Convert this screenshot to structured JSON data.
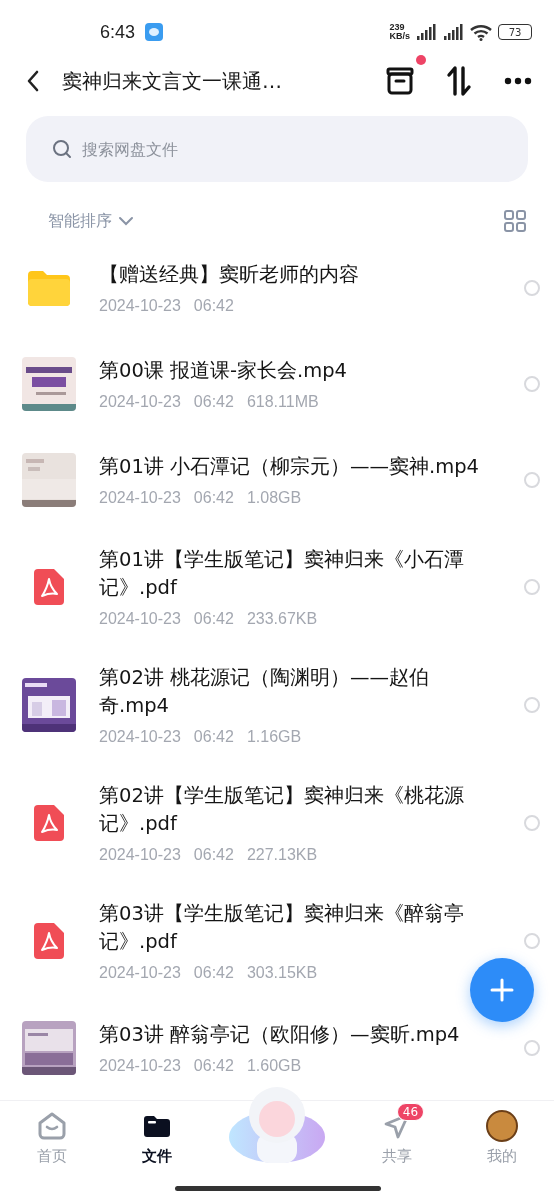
{
  "status_bar": {
    "time": "6:43",
    "speed": "239",
    "speed_unit": "KB/s",
    "battery": "73"
  },
  "header": {
    "title": "窦神归来文言文一课通…",
    "has_notice_dot": true
  },
  "search": {
    "placeholder": "搜索网盘文件"
  },
  "sort": {
    "label": "智能排序"
  },
  "files": [
    {
      "kind": "folder",
      "name": "【赠送经典】窦昕老师的内容",
      "meta": [
        "2024-10-23",
        "06:42"
      ],
      "selected": false
    },
    {
      "kind": "video",
      "name": "第00课 报道课-家长会.mp4",
      "meta": [
        "2024-10-23",
        "06:42",
        "618.11MB"
      ],
      "selected": false
    },
    {
      "kind": "video",
      "name": "第01讲 小石潭记（柳宗元）——窦神.mp4",
      "meta": [
        "2024-10-23",
        "06:42",
        "1.08GB"
      ],
      "selected": false
    },
    {
      "kind": "pdf",
      "name": "第01讲【学生版笔记】窦神归来《小石潭记》.pdf",
      "meta": [
        "2024-10-23",
        "06:42",
        "233.67KB"
      ],
      "selected": false
    },
    {
      "kind": "video",
      "name": "第02讲 桃花源记（陶渊明）——赵伯奇.mp4",
      "meta": [
        "2024-10-23",
        "06:42",
        "1.16GB"
      ],
      "selected": false
    },
    {
      "kind": "pdf",
      "name": "第02讲【学生版笔记】窦神归来《桃花源记》.pdf",
      "meta": [
        "2024-10-23",
        "06:42",
        "227.13KB"
      ],
      "selected": false
    },
    {
      "kind": "pdf",
      "name": "第03讲【学生版笔记】窦神归来《醉翁亭记》.pdf",
      "meta": [
        "2024-10-23",
        "06:42",
        "303.15KB"
      ],
      "selected": false
    },
    {
      "kind": "video",
      "name": "第03讲 醉翁亭记（欧阳修）—窦昕.mp4",
      "meta": [
        "2024-10-23",
        "06:42",
        "1.60GB"
      ],
      "selected": false
    }
  ],
  "nav": [
    {
      "kind": "home",
      "label": "首页",
      "selected": false
    },
    {
      "kind": "files",
      "label": "文件",
      "selected": true
    },
    {
      "kind": "mascot"
    },
    {
      "kind": "share",
      "label": "共享",
      "selected": false,
      "badge": "46"
    },
    {
      "kind": "me",
      "label": "我的",
      "selected": false
    }
  ]
}
